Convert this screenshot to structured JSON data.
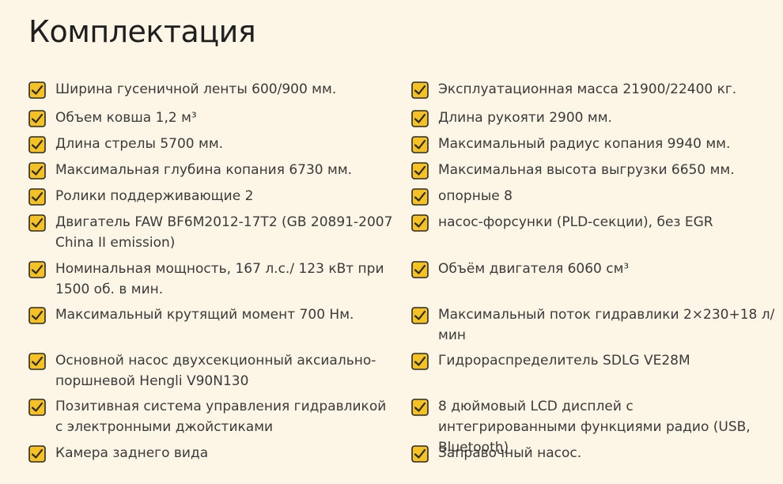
{
  "title": "Комплектация",
  "left": [
    "Ширина гусеничной ленты 600/900 мм.",
    "Объем ковша 1,2 м³",
    "Длина стрелы 5700 мм.",
    "Максимальная глубина копания 6730 мм.",
    "Ролики поддерживающие 2",
    "Двигатель FAW BF6M2012-17T2 (GB 20891-2007 China II emission)",
    "Номинальная мощность, 167 л.с./ 123 кВт при 1500 об. в мин.",
    "Максимальный крутящий момент 700 Нм.",
    "Основной насос двухсекционный аксиально-поршневой Hengli V90N130",
    "Позитивная система управления гидравликой с электронными джойстиками",
    "Камера заднего вида"
  ],
  "right": [
    "Эксплуатационная масса 21900/22400 кг.",
    "Длина рукояти 2900 мм.",
    "Максимальный радиус копания 9940 мм.",
    "Максимальная высота выгрузки 6650 мм.",
    "опорные 8",
    "насос-форсунки (PLD-секции), без EGR",
    "Объём двигателя 6060 см³",
    "Максимальный поток гидравлики 2×230+18 л/мин",
    "Гидрораспределитель SDLG VE28M",
    "8 дюймовый LCD дисплей с интегрированными функциями радио (USB, Bluetooth)",
    "Заправочный насос."
  ],
  "colors": {
    "background": "#fdf6e6",
    "checkbox_fill": "#f6c122",
    "checkbox_border": "#2a2a2a",
    "text": "#3a3a3a"
  },
  "icons": {
    "bullet": "checkbox-checked-icon"
  }
}
